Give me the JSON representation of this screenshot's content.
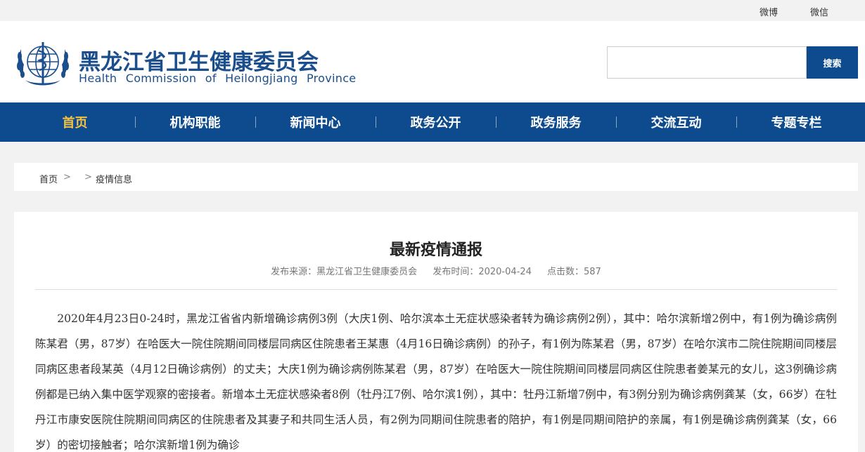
{
  "topbar": {
    "weibo": "微博",
    "weixin": "微信"
  },
  "header": {
    "title_cn": "黑龙江省卫生健康委员会",
    "title_en": "Health Commission of Heilongjiang Province",
    "emblem_icon": "who-emblem-icon",
    "search_placeholder": "",
    "search_button": "搜索"
  },
  "nav": {
    "items": [
      {
        "label": "首页",
        "active": true
      },
      {
        "label": "机构职能"
      },
      {
        "label": "新闻中心"
      },
      {
        "label": "政务公开"
      },
      {
        "label": "政务服务"
      },
      {
        "label": "交流互动"
      },
      {
        "label": "专题专栏"
      }
    ]
  },
  "breadcrumb": {
    "home": "首页",
    "sep1": ">",
    "sep2": ">",
    "current": "疫情信息"
  },
  "article": {
    "title": "最新疫情通报",
    "source": "发布来源：黑龙江省卫生健康委员会",
    "time": "发布时间：2020-04-24",
    "clicks": "点击数：587",
    "body": "2020年4月23日0-24时，黑龙江省省内新增确诊病例3例（大庆1例、哈尔滨本土无症状感染者转为确诊病例2例），其中：哈尔滨新增2例中，有1例为确诊病例陈某君（男，87岁）在哈医大一院住院期间同楼层同病区住院患者王某惠（4月16日确诊病例）的孙子，有1例为陈某君（男，87岁）在哈尔滨市二院住院期间同楼层同病区患者段某英（4月12日确诊病例）的丈夫；大庆1例为确诊病例陈某君（男，87岁）在哈医大一院住院期间同楼层同病区住院患者姜某元的女儿，这3例确诊病例都是已纳入集中医学观察的密接者。新增本土无症状感染者8例（牡丹江7例、哈尔滨1例），其中：牡丹江新增7例中，有3例分别为确诊病例龚某（女，66岁）在牡丹江市康安医院住院期间同病区的住院患者及其妻子和共同生活人员，有2例为同期间住院患者的陪护，有1例是同期间陪护的亲属，有1例是确诊病例龚某（女，66岁）的密切接触者；哈尔滨新增1例为确诊"
  }
}
